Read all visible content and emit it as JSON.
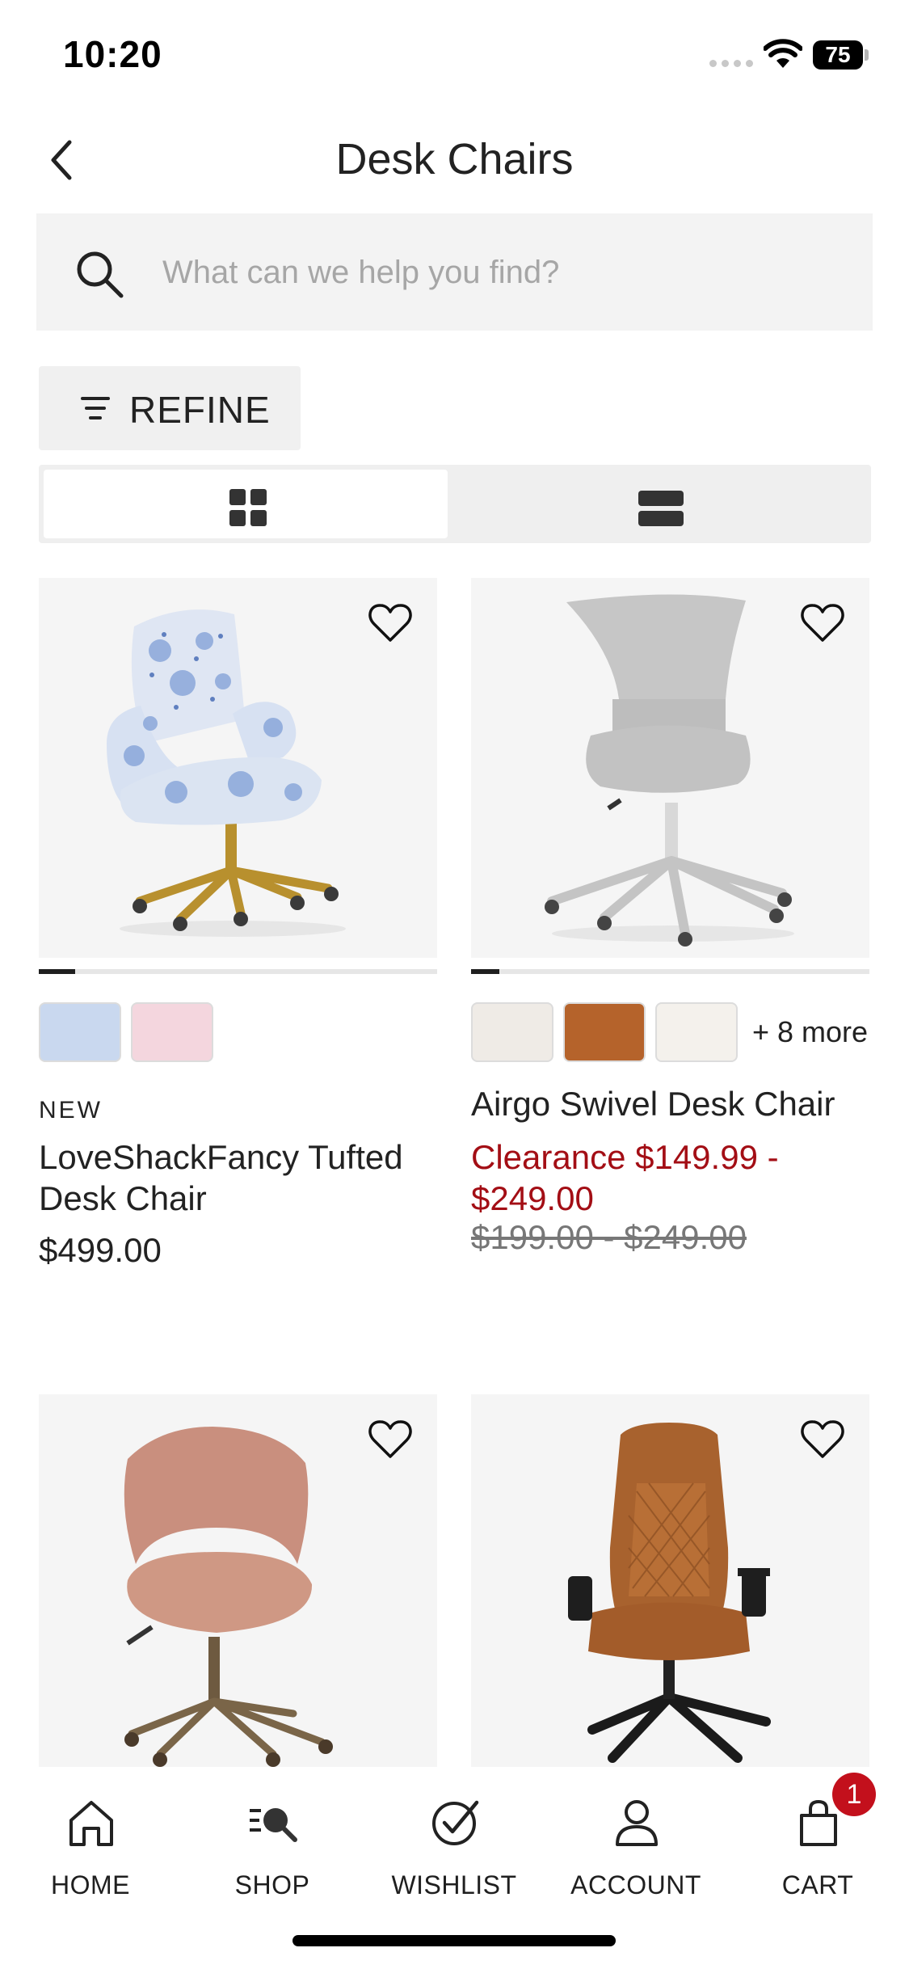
{
  "status_bar": {
    "time": "10:20",
    "battery": "75"
  },
  "header": {
    "title": "Desk Chairs",
    "back_icon": "chevron-left-icon"
  },
  "search": {
    "placeholder": "What can we help you find?",
    "value": "",
    "icon": "search-icon"
  },
  "filters": {
    "refine_label": "REFINE",
    "refine_icon": "filter-lines-icon"
  },
  "view_toggle": {
    "selected": "grid",
    "options": [
      "grid",
      "list"
    ]
  },
  "colors": {
    "sale_red": "#a30e15",
    "badge_red": "#c3101c",
    "text": "#1f1f1f",
    "panel_gray": "#f3f3f3"
  },
  "products": [
    {
      "badge": "NEW",
      "name": "LoveShackFancy Tufted Desk Chair",
      "price": "$499.00",
      "image_progress": 0.09,
      "swatch_colors": [
        "#c9d8ef",
        "#f4d6de"
      ]
    },
    {
      "name": "Airgo Swivel Desk Chair",
      "sale_price": "Clearance $149.99 - $249.00",
      "original_price": "$199.00 - $249.00",
      "image_progress": 0.07,
      "swatch_colors": [
        "#efebe6",
        "#b5632b",
        "#f4f1ec"
      ],
      "more_swatches": "+ 8 more"
    },
    {
      "image_icon": "blush-velvet-chair-image"
    },
    {
      "image_icon": "leather-gaming-chair-image"
    }
  ],
  "bottom_nav": {
    "items": [
      {
        "label": "HOME",
        "icon": "home-icon"
      },
      {
        "label": "SHOP",
        "icon": "shop-search-icon"
      },
      {
        "label": "WISHLIST",
        "icon": "check-circle-icon"
      },
      {
        "label": "ACCOUNT",
        "icon": "person-icon"
      },
      {
        "label": "CART",
        "icon": "bag-icon"
      }
    ],
    "cart_count": "1"
  }
}
